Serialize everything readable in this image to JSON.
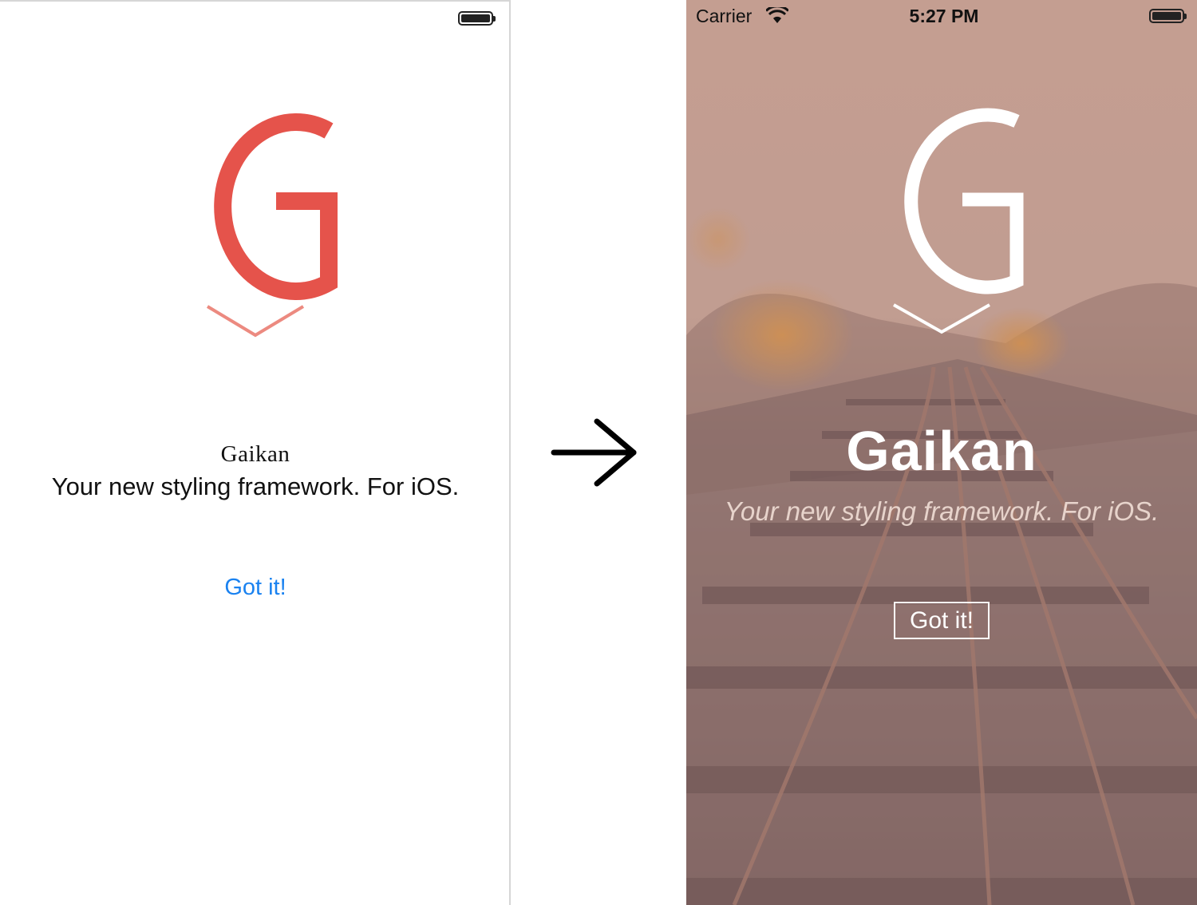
{
  "left_screen": {
    "title": "Gaikan",
    "subtitle": "Your new styling framework. For iOS.",
    "button_label": "Got it!",
    "logo_color": "#e5534b",
    "button_color": "#1a82f0"
  },
  "transition": {
    "icon": "right-arrow-icon"
  },
  "right_screen": {
    "status_bar": {
      "carrier": "Carrier",
      "time": "5:27 PM"
    },
    "title": "Gaikan",
    "subtitle": "Your new styling framework. For iOS.",
    "button_label": "Got it!",
    "logo_color": "#ffffff",
    "tint": "#b9958a"
  }
}
